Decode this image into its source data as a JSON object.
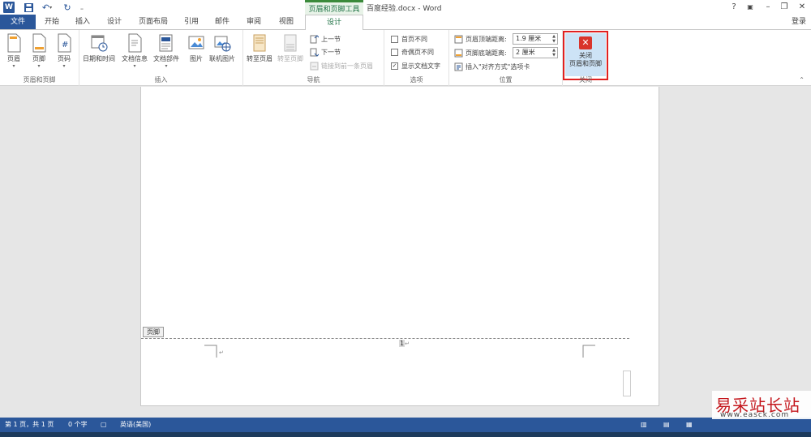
{
  "titlebar": {
    "context_tool_title": "页眉和页脚工具",
    "document_title": "百度经验.docx - Word",
    "help": "?",
    "minimize": "–",
    "restore": "❐",
    "close": "✕"
  },
  "tabs": {
    "file": "文件",
    "home": "开始",
    "insert": "插入",
    "design_main": "设计",
    "layout": "页面布局",
    "references": "引用",
    "mailings": "邮件",
    "review": "审阅",
    "view": "视图",
    "design_ctx": "设计",
    "login": "登录"
  },
  "ribbon": {
    "hf_group": {
      "label": "页眉和页脚",
      "header": "页眉",
      "footer": "页脚",
      "page_number": "页码"
    },
    "insert_group": {
      "label": "插入",
      "datetime": "日期和时间",
      "docinfo": "文档信息",
      "quickparts": "文档部件",
      "picture": "图片",
      "online_picture": "联机图片"
    },
    "nav_group": {
      "label": "导航",
      "goto_header": "转至页眉",
      "goto_footer": "转至页脚",
      "prev": "上一节",
      "next": "下一节",
      "link_prev": "链接到前一条页眉"
    },
    "options_group": {
      "label": "选项",
      "diff_first": "首页不同",
      "diff_odd_even": "奇偶页不同",
      "show_doc_text": "显示文档文字",
      "diff_first_checked": false,
      "diff_odd_even_checked": false,
      "show_doc_text_checked": true
    },
    "position_group": {
      "label": "位置",
      "header_top_label": "页眉顶端距离:",
      "header_top_value": "1.9 厘米",
      "footer_bottom_label": "页脚底端距离:",
      "footer_bottom_value": "2 厘米",
      "insert_align_tab": "插入\"对齐方式\"选项卡"
    },
    "close_group": {
      "label": "关闭",
      "close_line1": "关闭",
      "close_line2": "页眉和页脚"
    }
  },
  "document": {
    "footer_tag": "页脚",
    "page_number": "1",
    "para_mark": "↵"
  },
  "statusbar": {
    "page_info": "第 1 页，共 1 页",
    "word_count": "0 个字",
    "language": "英语(美国)"
  },
  "watermark": {
    "brand_cn": "易采站长站",
    "brand_url": "www.easck.com"
  },
  "colors": {
    "word_blue": "#2b579a",
    "context_green": "#217346",
    "close_red": "#d9342b",
    "highlight_border": "#e02020"
  }
}
